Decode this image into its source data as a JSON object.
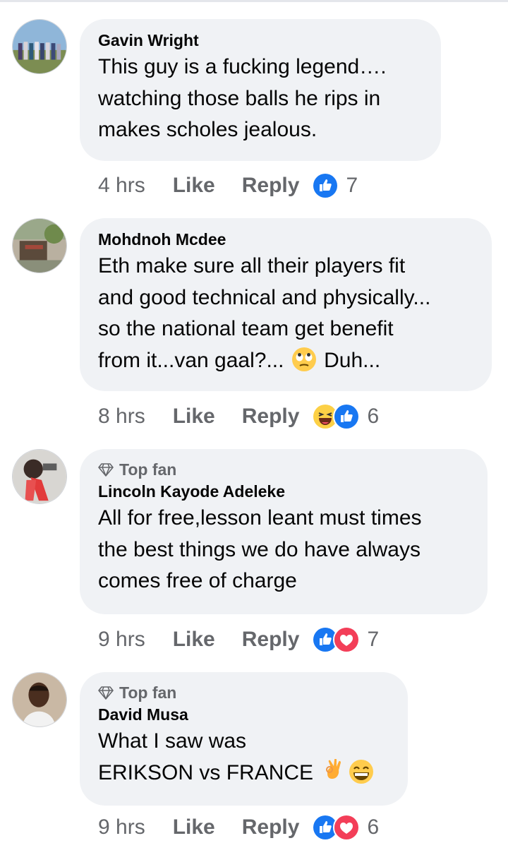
{
  "comments": [
    {
      "author": "Gavin Wright",
      "badge": "",
      "lines": [
        "This guy is a fucking legend….",
        "watching those balls he rips in",
        "makes scholes jealous."
      ],
      "time": "4 hrs",
      "like_label": "Like",
      "reply_label": "Reply",
      "reactions": [
        "like-icon"
      ],
      "reaction_count": "7"
    },
    {
      "author": "Mohdnoh Mcdee",
      "badge": "",
      "lines": [
        "Eth make sure all their players fit",
        "and good technical and physically...",
        "so the national team get benefit",
        "from it...van gaal?...",
        "Duh..."
      ],
      "time": "8 hrs",
      "like_label": "Like",
      "reply_label": "Reply",
      "reactions": [
        "haha-icon",
        "like-icon"
      ],
      "reaction_count": "6"
    },
    {
      "author": "Lincoln Kayode Adeleke",
      "badge": "Top fan",
      "lines": [
        "All for free,lesson leant must times",
        "the best things we do have always",
        "comes free of charge"
      ],
      "time": "9 hrs",
      "like_label": "Like",
      "reply_label": "Reply",
      "reactions": [
        "like-icon",
        "love-icon"
      ],
      "reaction_count": "7"
    },
    {
      "author": "David Musa",
      "badge": "Top fan",
      "lines": [
        "What I saw was",
        "ERIKSON vs FRANCE"
      ],
      "time": "9 hrs",
      "like_label": "Like",
      "reply_label": "Reply",
      "reactions": [
        "like-icon",
        "love-icon"
      ],
      "reaction_count": "6"
    }
  ],
  "colors": {
    "bubble": "#f0f2f5",
    "meta_text": "#65676b",
    "like_blue": "#1877f2",
    "love_red": "#f33e58"
  }
}
